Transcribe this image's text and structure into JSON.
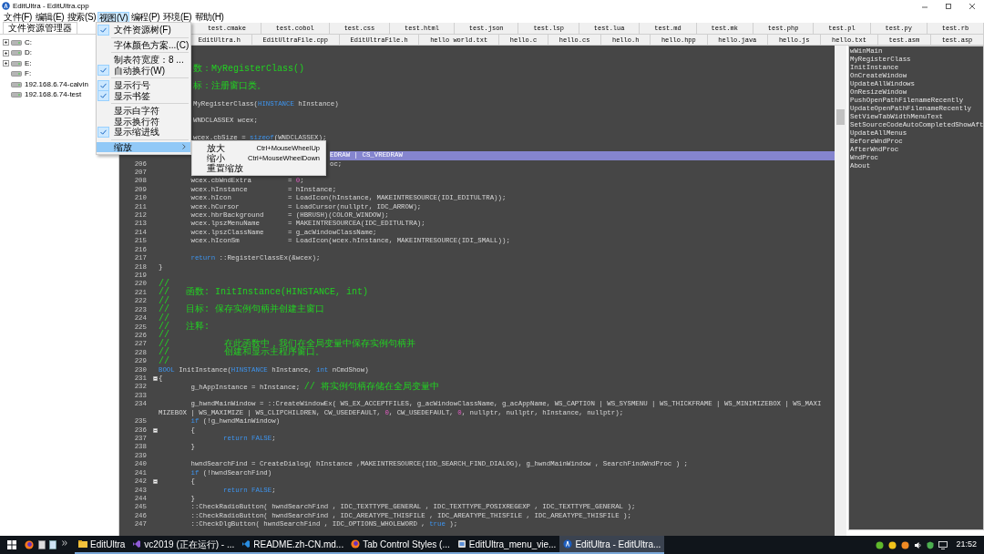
{
  "window": {
    "title": "EditUltra - EditUltra.cpp"
  },
  "menubar": {
    "items": [
      {
        "label": "文件(F)",
        "selected": false
      },
      {
        "label": "编辑(E)",
        "selected": false
      },
      {
        "label": "搜索(S)",
        "selected": false
      },
      {
        "label": "视图(V)",
        "selected": true
      },
      {
        "label": "编程(P)",
        "selected": false
      },
      {
        "label": "环境(E)",
        "selected": false
      },
      {
        "label": "帮助(H)",
        "selected": false
      }
    ]
  },
  "view_menu": {
    "items": [
      {
        "kind": "item",
        "label": "文件资源树(F)",
        "checked": true,
        "selected": false
      },
      {
        "kind": "separator"
      },
      {
        "kind": "item",
        "label": "字体颜色方案...(C)",
        "checked": false,
        "selected": false
      },
      {
        "kind": "separator"
      },
      {
        "kind": "item",
        "label": "制表符宽度：8 ...",
        "checked": false,
        "selected": false
      },
      {
        "kind": "item",
        "label": "自动换行(W)",
        "checked": true,
        "selected": false
      },
      {
        "kind": "separator"
      },
      {
        "kind": "item",
        "label": "显示行号",
        "checked": true,
        "selected": false
      },
      {
        "kind": "item",
        "label": "显示书签",
        "checked": true,
        "selected": false
      },
      {
        "kind": "separator"
      },
      {
        "kind": "item",
        "label": "显示白字符",
        "checked": false,
        "selected": false
      },
      {
        "kind": "item",
        "label": "显示换行符",
        "checked": false,
        "selected": false
      },
      {
        "kind": "item",
        "label": "显示缩进线",
        "checked": true,
        "selected": false
      },
      {
        "kind": "separator"
      },
      {
        "kind": "submenu",
        "label": "缩放",
        "checked": false,
        "selected": true
      }
    ]
  },
  "zoom_submenu": {
    "items": [
      {
        "label": "放大",
        "shortcut": "Ctrl+MouseWheelUp"
      },
      {
        "label": "缩小",
        "shortcut": "Ctrl+MouseWheelDown"
      },
      {
        "label": "重置缩放"
      }
    ]
  },
  "file_explorer": {
    "tab": "文件资源管理器",
    "items": [
      {
        "label": "C:",
        "expandable": true
      },
      {
        "label": "D:",
        "expandable": true
      },
      {
        "label": "E:",
        "expandable": true
      },
      {
        "label": "F:",
        "expandable": false
      },
      {
        "label": "192.168.6.74-calvin",
        "expandable": false
      },
      {
        "label": "192.168.6.74-test",
        "expandable": false
      }
    ]
  },
  "tabs": {
    "row_1": [
      "test.cmake",
      "test.cobol",
      "test.css",
      "test.html",
      "test.json",
      "test.lsp",
      "test.lua",
      "test.md",
      "test.mk",
      "test.php",
      "test.pl",
      "test.py",
      "test.rb"
    ],
    "row_2": [
      "EditUltra.h",
      "EditUltraFile.cpp",
      "EditUltraFile.h",
      "hello world.txt",
      "hello.c",
      "hello.cs",
      "hello.h",
      "hello.hpp",
      "hello.java",
      "hello.js",
      "hello.txt",
      "test.asm",
      "test.asp"
    ]
  },
  "code_lines": [
    {
      "kind": "after-menu",
      "segments": [
        {
          "kind": "comment",
          "text": "数：MyRegisterClass()"
        }
      ]
    },
    {
      "kind": "after-menu",
      "segments": [
        {
          "kind": "comment",
          "text": "标：注册窗口类。"
        }
      ]
    },
    {
      "kind": "after-menu",
      "segments": [
        {
          "kind": "plain",
          "text": "MyRegisterClass("
        },
        {
          "kind": "keyword",
          "text": "HINSTANCE"
        },
        {
          "kind": "plain",
          "text": " hInstance)"
        }
      ]
    },
    {
      "kind": "after-menu",
      "segments": [
        {
          "kind": "plain",
          "text": "WNDCLASSEX wcex;"
        }
      ]
    },
    {
      "kind": "after-menu",
      "segments": [
        {
          "kind": "plain",
          "text": "wcex.cbSize = "
        },
        {
          "kind": "keyword",
          "text": "sizeof"
        },
        {
          "kind": "plain",
          "text": "(WNDCLASSEX);"
        }
      ]
    },
    {
      "kind": "after-submenu",
      "current": true,
      "segments": [
        {
          "kind": "plain",
          "text": "EDRAW | CS_VREDRAW"
        }
      ]
    },
    {
      "kind": "after-submenu",
      "number": "206",
      "segments": [
        {
          "kind": "plain",
          "text": "oc;"
        }
      ]
    },
    {
      "number": "207"
    },
    {
      "number": "208",
      "segments": [
        {
          "kind": "plain",
          "text": "        wcex.cbWndExtra         = "
        },
        {
          "kind": "number",
          "text": "0"
        },
        {
          "kind": "plain",
          "text": ";"
        }
      ]
    },
    {
      "number": "209",
      "segments": [
        {
          "kind": "plain",
          "text": "        wcex.hInstance          = hInstance;"
        }
      ]
    },
    {
      "number": "210",
      "segments": [
        {
          "kind": "plain",
          "text": "        wcex.hIcon              = LoadIcon(hInstance, MAKEINTRESOURCE(IDI_EDITULTRA));"
        }
      ]
    },
    {
      "number": "211",
      "segments": [
        {
          "kind": "plain",
          "text": "        wcex.hCursor            = LoadCursor(nullptr, IDC_ARROW);"
        }
      ]
    },
    {
      "number": "212",
      "segments": [
        {
          "kind": "plain",
          "text": "        wcex.hbrBackground      = (HBRUSH)(COLOR_WINDOW);"
        }
      ]
    },
    {
      "number": "213",
      "segments": [
        {
          "kind": "plain",
          "text": "        wcex.lpszMenuName       = MAKEINTRESOURCEA(IDC_EDITULTRA);"
        }
      ]
    },
    {
      "number": "214",
      "segments": [
        {
          "kind": "plain",
          "text": "        wcex.lpszClassName      = g_acWindowClassName;"
        }
      ]
    },
    {
      "number": "215",
      "segments": [
        {
          "kind": "plain",
          "text": "        wcex.hIconSm            = LoadIcon(wcex.hInstance, MAKEINTRESOURCE(IDI_SMALL));"
        }
      ]
    },
    {
      "number": "216"
    },
    {
      "number": "217",
      "segments": [
        {
          "kind": "keyword",
          "text": "        return"
        },
        {
          "kind": "plain",
          "text": " ::RegisterClassEx(&wcex);"
        }
      ]
    },
    {
      "number": "218",
      "segments": [
        {
          "kind": "plain",
          "text": "}"
        }
      ]
    },
    {
      "number": "219"
    },
    {
      "number": "220",
      "segments": [
        {
          "kind": "comment",
          "text": "//"
        }
      ]
    },
    {
      "number": "221",
      "segments": [
        {
          "kind": "comment",
          "text": "//   函数: InitInstance(HINSTANCE, int)"
        }
      ]
    },
    {
      "number": "222",
      "segments": [
        {
          "kind": "comment",
          "text": "//"
        }
      ]
    },
    {
      "number": "223",
      "segments": [
        {
          "kind": "comment",
          "text": "//   目标: 保存实例句柄并创建主窗口"
        }
      ]
    },
    {
      "number": "224",
      "segments": [
        {
          "kind": "comment",
          "text": "//"
        }
      ]
    },
    {
      "number": "225",
      "segments": [
        {
          "kind": "comment",
          "text": "//   注释:"
        }
      ]
    },
    {
      "number": "226",
      "segments": [
        {
          "kind": "comment",
          "text": "//"
        }
      ]
    },
    {
      "number": "227",
      "segments": [
        {
          "kind": "comment",
          "text": "//          在此函数中，我们在全局变量中保存实例句柄并"
        }
      ]
    },
    {
      "number": "228",
      "segments": [
        {
          "kind": "comment",
          "text": "//          创建和显示主程序窗口。"
        }
      ]
    },
    {
      "number": "229",
      "segments": [
        {
          "kind": "comment",
          "text": "//"
        }
      ]
    },
    {
      "number": "230",
      "segments": [
        {
          "kind": "keyword",
          "text": "BOOL"
        },
        {
          "kind": "plain",
          "text": " InitInstance("
        },
        {
          "kind": "keyword",
          "text": "HINSTANCE"
        },
        {
          "kind": "plain",
          "text": " hInstance, "
        },
        {
          "kind": "keyword",
          "text": "int"
        },
        {
          "kind": "plain",
          "text": " nCmdShow)"
        }
      ]
    },
    {
      "number": "231",
      "fold": true,
      "segments": [
        {
          "kind": "plain",
          "text": "{"
        }
      ]
    },
    {
      "number": "232",
      "segments": [
        {
          "kind": "plain",
          "text": "        g_hAppInstance = hInstance; "
        },
        {
          "kind": "comment",
          "text": "// 将实例句柄存储在全局变量中"
        }
      ]
    },
    {
      "number": "233"
    },
    {
      "number": "234",
      "segments": [
        {
          "kind": "plain",
          "text": "        g_hwndMainWindow = ::CreateWindowEx( WS_EX_ACCEPTFILES, g_acWindowClassName, g_acAppName, WS_CAPTION | WS_SYSMENU | WS_THICKFRAME | WS_MINIMIZEBOX | WS_MAXI"
        }
      ]
    },
    {
      "segments": [
        {
          "kind": "plain",
          "text": "MIZEBOX | WS_MAXIMIZE | WS_CLIPCHILDREN, CW_USEDEFAULT, "
        },
        {
          "kind": "number",
          "text": "0"
        },
        {
          "kind": "plain",
          "text": ", CW_USEDEFAULT, "
        },
        {
          "kind": "number",
          "text": "0"
        },
        {
          "kind": "plain",
          "text": ", nullptr, nullptr, hInstance, nullptr);"
        }
      ]
    },
    {
      "number": "235",
      "segments": [
        {
          "kind": "keyword",
          "text": "        if"
        },
        {
          "kind": "plain",
          "text": " (!g_hwndMainWindow)"
        }
      ]
    },
    {
      "number": "236",
      "fold": true,
      "segments": [
        {
          "kind": "plain",
          "text": "        {"
        }
      ]
    },
    {
      "number": "237",
      "segments": [
        {
          "kind": "keyword",
          "text": "                return FALSE"
        },
        {
          "kind": "plain",
          "text": ";"
        }
      ]
    },
    {
      "number": "238",
      "segments": [
        {
          "kind": "plain",
          "text": "        }"
        }
      ]
    },
    {
      "number": "239"
    },
    {
      "number": "240",
      "segments": [
        {
          "kind": "plain",
          "text": "        hwndSearchFind = CreateDialog( hInstance ,MAKEINTRESOURCE(IDD_SEARCH_FIND_DIALOG), g_hwndMainWindow , SearchFindWndProc ) ;"
        }
      ]
    },
    {
      "number": "241",
      "segments": [
        {
          "kind": "keyword",
          "text": "        if"
        },
        {
          "kind": "plain",
          "text": " (!hwndSearchFind)"
        }
      ]
    },
    {
      "number": "242",
      "fold": true,
      "segments": [
        {
          "kind": "plain",
          "text": "        {"
        }
      ]
    },
    {
      "number": "243",
      "segments": [
        {
          "kind": "keyword",
          "text": "                return FALSE"
        },
        {
          "kind": "plain",
          "text": ";"
        }
      ]
    },
    {
      "number": "244",
      "segments": [
        {
          "kind": "plain",
          "text": "        }"
        }
      ]
    },
    {
      "number": "245",
      "segments": [
        {
          "kind": "plain",
          "text": "        ::CheckRadioButton( hwndSearchFind , IDC_TEXTTYPE_GENERAL , IDC_TEXTTYPE_POSIXREGEXP , IDC_TEXTTYPE_GENERAL );"
        }
      ]
    },
    {
      "number": "246",
      "segments": [
        {
          "kind": "plain",
          "text": "        ::CheckRadioButton( hwndSearchFind , IDC_AREATYPE_THISFILE , IDC_AREATYPE_THISFILE , IDC_AREATYPE_THISFILE );"
        }
      ]
    },
    {
      "number": "247",
      "segments": [
        {
          "kind": "plain",
          "text": "        ::CheckDlgButton( hwndSearchFind , IDC_OPTIONS_WHOLEWORD , "
        },
        {
          "kind": "keyword",
          "text": "true"
        },
        {
          "kind": "plain",
          "text": " );"
        }
      ]
    }
  ],
  "function_list": [
    "wWinMain",
    "MyRegisterClass",
    "InitInstance",
    "OnCreateWindow",
    "UpdateAllWindows",
    "OnResizeWindow",
    "PushOpenPathFilenameRecently",
    "UpdateOpenPathFilenameRecently",
    "SetViewTabWidthMenuText",
    "SetSourceCodeAutoCompletedShowAft",
    "UpdateAllMenus",
    "BeforeWndProc",
    "AfterWndProc",
    "WndProc",
    "About"
  ],
  "taskbar": {
    "tasks": [
      {
        "label": "EditUltra",
        "selected": false
      },
      {
        "label": "vc2019 (正在运行) - ...",
        "selected": false
      },
      {
        "label": "README.zh-CN.md...",
        "selected": false
      },
      {
        "label": "Tab Control Styles (...",
        "selected": false
      },
      {
        "label": "EditUltra_menu_vie...",
        "selected": false
      },
      {
        "label": "EditUltra - EditUltra...",
        "selected": true
      }
    ],
    "clock": "21:52"
  }
}
